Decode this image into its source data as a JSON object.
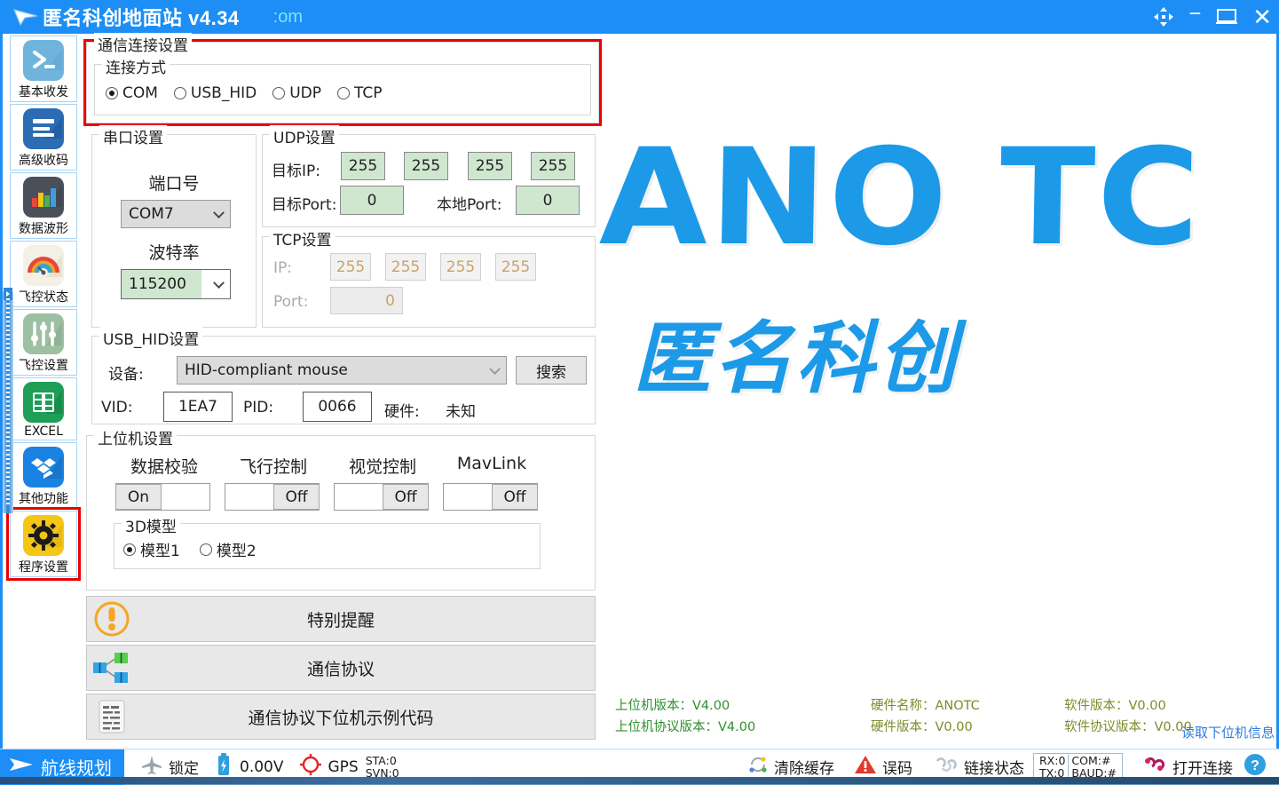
{
  "window": {
    "title": "匿名科创地面站 v4.34",
    "title_extra": ":om",
    "controls": {
      "move": "move-icon",
      "minimize": "−",
      "maximize": "maximize-icon",
      "close": "✕"
    }
  },
  "sidebar": {
    "items": [
      {
        "label": "基本收发",
        "icon": "terminal-icon",
        "selected": false
      },
      {
        "label": "高级收码",
        "icon": "lines-icon",
        "selected": false
      },
      {
        "label": "数据波形",
        "icon": "bar-chart-icon",
        "selected": false
      },
      {
        "label": "飞控状态",
        "icon": "gauge-icon",
        "selected": false
      },
      {
        "label": "飞控设置",
        "icon": "sliders-icon",
        "selected": false
      },
      {
        "label": "EXCEL",
        "icon": "table-icon",
        "selected": false
      },
      {
        "label": "其他功能",
        "icon": "dropbox-icon",
        "selected": false
      },
      {
        "label": "程序设置",
        "icon": "gear-icon",
        "selected": true
      }
    ]
  },
  "comm": {
    "group_title": "通信连接设置",
    "method_title": "连接方式",
    "methods": [
      {
        "label": "COM",
        "selected": true
      },
      {
        "label": "USB_HID",
        "selected": false
      },
      {
        "label": "UDP",
        "selected": false
      },
      {
        "label": "TCP",
        "selected": false
      }
    ]
  },
  "serial": {
    "title": "串口设置",
    "port_label": "端口号",
    "port_value": "COM7",
    "baud_label": "波特率",
    "baud_value": "115200"
  },
  "udp": {
    "title": "UDP设置",
    "target_ip_label": "目标IP:",
    "target_ip": [
      "255",
      "255",
      "255",
      "255"
    ],
    "target_port_label": "目标Port:",
    "target_port": "0",
    "local_port_label": "本地Port:",
    "local_port": "0"
  },
  "tcp": {
    "title": "TCP设置",
    "ip_label": "IP:",
    "ip": [
      "255",
      "255",
      "255",
      "255"
    ],
    "port_label": "Port:",
    "port": "0"
  },
  "usbhid": {
    "title": "USB_HID设置",
    "device_label": "设备:",
    "device_value": "HID-compliant mouse",
    "search_button": "搜索",
    "vid_label": "VID:",
    "vid_value": "1EA7",
    "pid_label": "PID:",
    "pid_value": "0066",
    "hw_label": "硬件:",
    "hw_value": "未知"
  },
  "host": {
    "title": "上位机设置",
    "toggles": [
      {
        "label": "数据校验",
        "state": "On"
      },
      {
        "label": "飞行控制",
        "state": "Off"
      },
      {
        "label": "视觉控制",
        "state": "Off"
      },
      {
        "label": "MavLink",
        "state": "Off"
      }
    ],
    "model": {
      "title": "3D模型",
      "options": [
        {
          "label": "模型1",
          "selected": true
        },
        {
          "label": "模型2",
          "selected": false
        }
      ]
    }
  },
  "actions": [
    {
      "label": "特别提醒",
      "icon": "warning-circle-icon"
    },
    {
      "label": "通信协议",
      "icon": "sitemap-icon"
    },
    {
      "label": "通信协议下位机示例代码",
      "icon": "document-code-icon"
    }
  ],
  "logo": {
    "main": "ANO TC",
    "sub": "匿名科创"
  },
  "versions": [
    {
      "text": "上位机版本：V4.00",
      "color": "#2f8f2f"
    },
    {
      "text": "上位机协议版本：V4.00",
      "color": "#2f8f2f"
    },
    {
      "text": "硬件名称：ANOTC",
      "color": "#7d8c2a"
    },
    {
      "text": "硬件版本：V0.00",
      "color": "#7d8c2a"
    },
    {
      "text": "软件版本：V0.00",
      "color": "#7d8c2a"
    },
    {
      "text": "软件协议版本：V0.00",
      "color": "#7d8c2a"
    }
  ],
  "read_info_link": "读取下位机信息",
  "statusbar": {
    "route": "航线规划",
    "lock": "锁定",
    "voltage": "0.00V",
    "gps": "GPS",
    "sta": "STA:0",
    "svn": "SVN:0",
    "clear_cache": "清除缓存",
    "error": "误码",
    "link_state": "链接状态",
    "rx": "RX:0",
    "tx": "TX:0",
    "com": "COM:#",
    "baud": "BAUD:#",
    "open_conn": "打开连接",
    "help": "?"
  },
  "colors": {
    "accent": "#1c8ef5",
    "logo": "#1c9ae8",
    "highlight_box": "#ee0000",
    "field_green": "#cfe6cf",
    "version_green": "#2f8f2f",
    "version_olive": "#7d8c2a",
    "link_blue": "#2b7de0"
  }
}
